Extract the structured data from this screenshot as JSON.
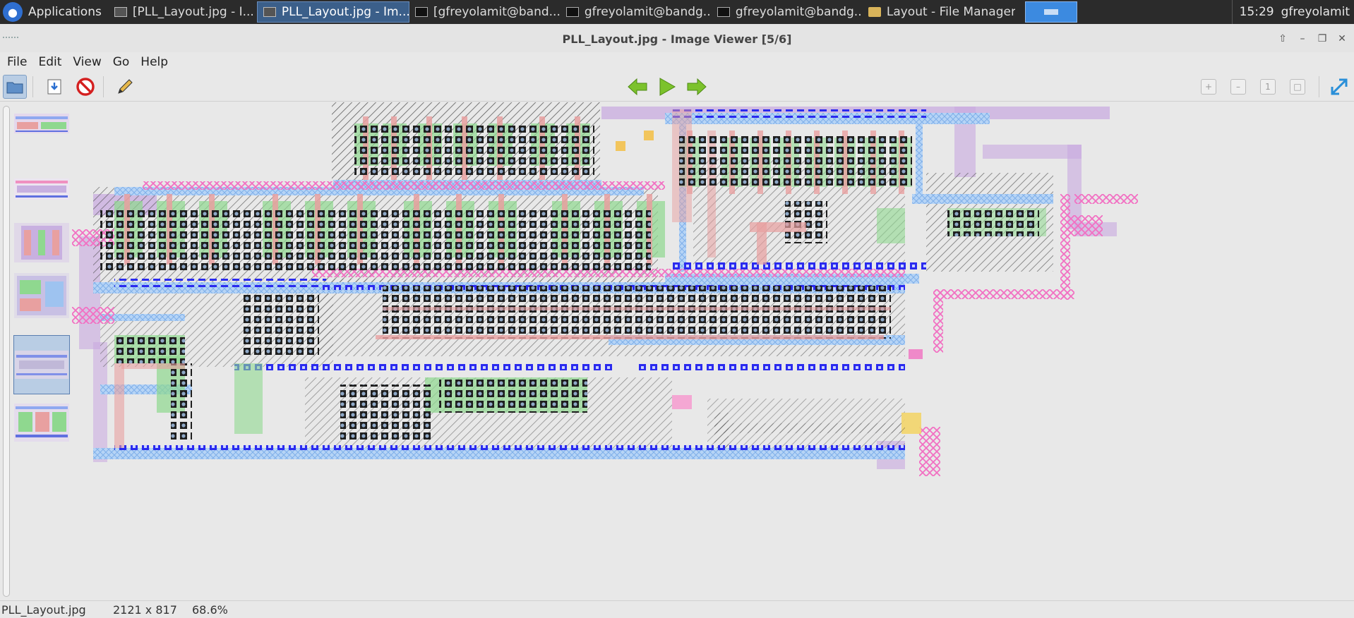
{
  "taskbar": {
    "apps_label": "Applications",
    "tasks": [
      {
        "label": "[PLL_Layout.jpg - I...",
        "icon": "image-viewer-icon",
        "active": false
      },
      {
        "label": "PLL_Layout.jpg - Im...",
        "icon": "image-viewer-icon",
        "active": true
      },
      {
        "label": "[gfreyolamit@band...",
        "icon": "terminal-icon",
        "active": false
      },
      {
        "label": "gfreyolamit@bandg...",
        "icon": "terminal-icon",
        "active": false
      },
      {
        "label": "gfreyolamit@bandg...",
        "icon": "terminal-icon",
        "active": false
      },
      {
        "label": "Layout - File Manager",
        "icon": "folder-icon",
        "active": false
      }
    ],
    "clock": "15:29",
    "user": "gfreyolamit"
  },
  "window": {
    "title": "PLL_Layout.jpg - Image Viewer [5/6]"
  },
  "menu": [
    "File",
    "Edit",
    "View",
    "Go",
    "Help"
  ],
  "statusbar": {
    "filename": "PLL_Layout.jpg",
    "dimensions": "2121 x 817",
    "zoom": "68.6%"
  },
  "colors": {
    "poly": "#e8a0a0",
    "metal1": "#9ec3f0",
    "metal2": "#c8a8e0",
    "diffusion": "#8fd88f",
    "contact": "#1a1a1a",
    "via": "#3030e8",
    "implant": "#f070c0"
  }
}
